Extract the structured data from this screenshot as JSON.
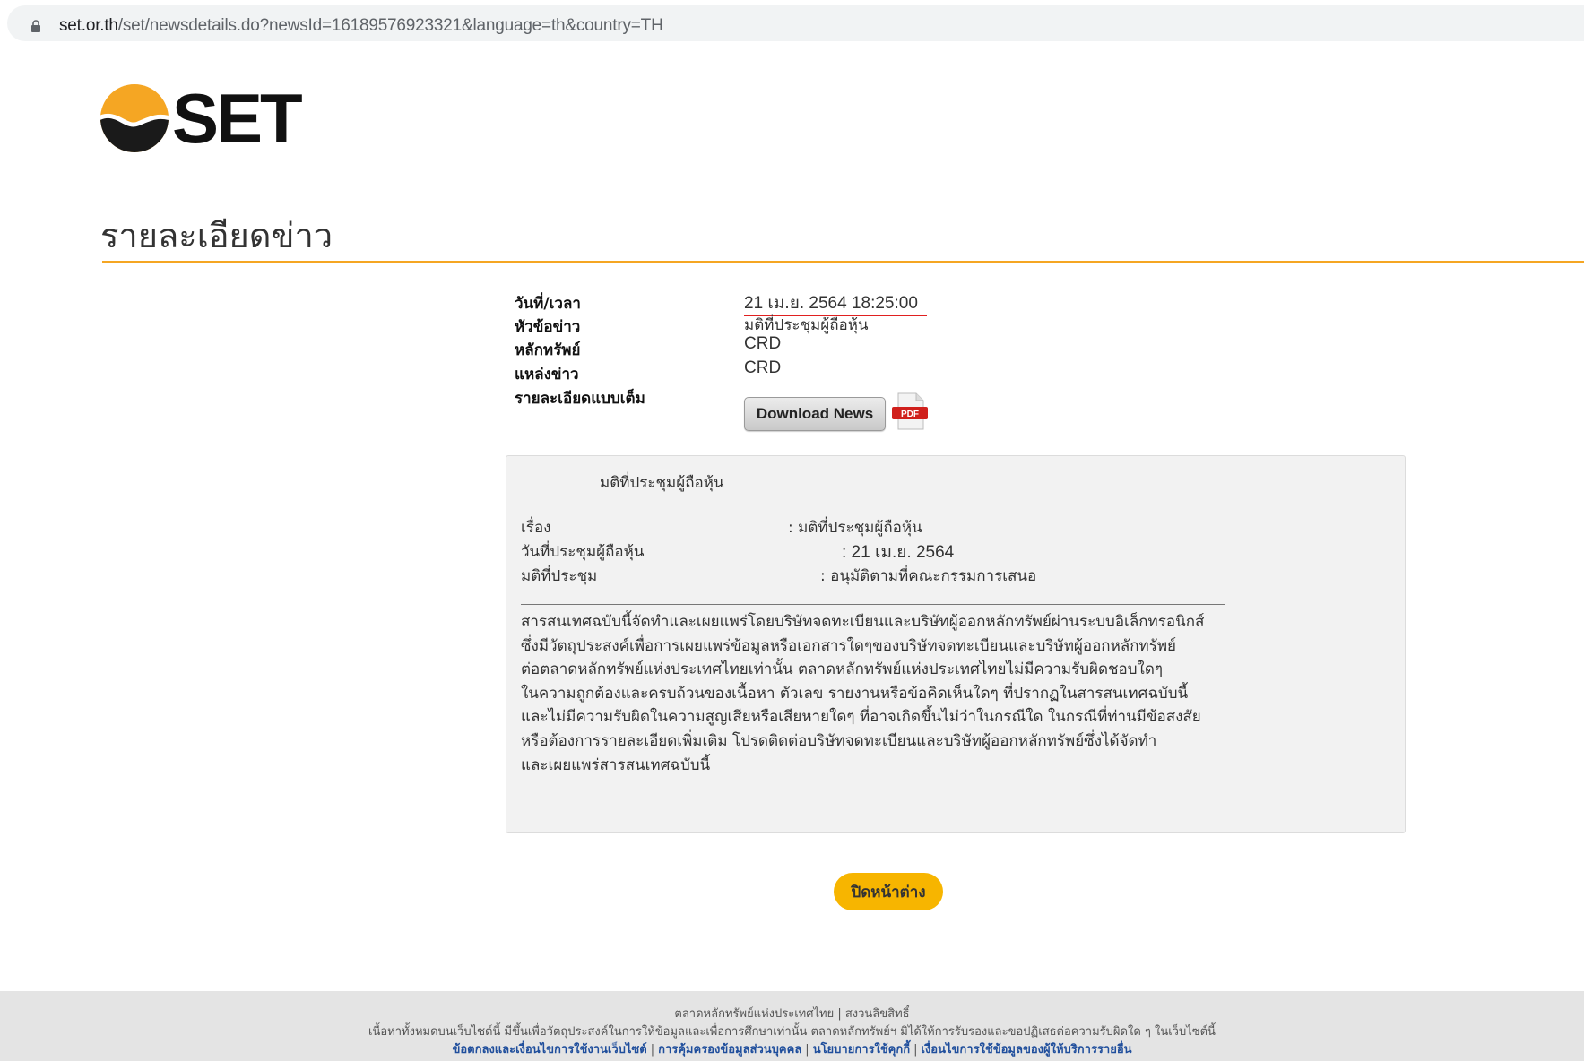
{
  "browser": {
    "url_host": "set.or.th",
    "url_path": "/set/newsdetails.do?newsId=16189576923321&language=th&country=TH"
  },
  "logo": {
    "text": "SET"
  },
  "page": {
    "title": "รายละเอียดข่าว"
  },
  "info": {
    "date_label": "วันที่/เวลา",
    "date_value": "21 เม.ย. 2564 18:25:00",
    "headline_label": "หัวข้อข่าว",
    "headline_value": "มติที่ประชุมผู้ถือหุ้น",
    "security_label": "หลักทรัพย์",
    "security_value": "CRD",
    "source_label": "แหล่งข่าว",
    "source_value": "CRD",
    "original_label": "รายละเอียดแบบเต็ม",
    "download_label": "Download News",
    "pdf_label": "PDF"
  },
  "content": {
    "heading": "มติที่ประชุมผู้ถือหุ้น",
    "rows": [
      {
        "key": "เรื่อง",
        "value": ": มติที่ประชุมผู้ถือหุ้น"
      },
      {
        "key": "วันที่ประชุมผู้ถือหุ้น",
        "value": ": 21 เม.ย. 2564"
      },
      {
        "key": "มติที่ประชุม",
        "value": ": อนุมัติตามที่คณะกรรมการเสนอ"
      }
    ],
    "disclaimer": [
      "สารสนเทศฉบับนี้จัดทำและเผยแพร่โดยบริษัทจดทะเบียนและบริษัทผู้ออกหลักทรัพย์ผ่านระบบอิเล็กทรอนิกส์",
      "ซึ่งมีวัตถุประสงค์เพื่อการเผยแพร่ข้อมูลหรือเอกสารใดๆของบริษัทจดทะเบียนและบริษัทผู้ออกหลักทรัพย์",
      "ต่อตลาดหลักทรัพย์แห่งประเทศไทยเท่านั้น ตลาดหลักทรัพย์แห่งประเทศไทยไม่มีความรับผิดชอบใดๆ",
      "ในความถูกต้องและครบถ้วนของเนื้อหา ตัวเลข รายงานหรือข้อคิดเห็นใดๆ ที่ปรากฏในสารสนเทศฉบับนี้",
      "และไม่มีความรับผิดในความสูญเสียหรือเสียหายใดๆ ที่อาจเกิดขึ้นไม่ว่าในกรณีใด ในกรณีที่ท่านมีข้อสงสัย",
      "หรือต้องการรายละเอียดเพิ่มเติม โปรดติดต่อบริษัทจดทะเบียนและบริษัทผู้ออกหลักทรัพย์ซึ่งได้จัดทำ",
      "และเผยแพร่สารสนเทศฉบับนี้"
    ]
  },
  "close_label": "ปิดหน้าต่าง",
  "footer": {
    "copyright": "ตลาดหลักทรัพย์แห่งประเทศไทย | สงวนลิขสิทธิ์",
    "notice": "เนื้อหาทั้งหมดบนเว็บไซต์นี้ มีขึ้นเพื่อวัตถุประสงค์ในการให้ข้อมูลและเพื่อการศึกษาเท่านั้น ตลาดหลักทรัพย์ฯ มิได้ให้การรับรองและขอปฏิเสธต่อความรับผิดใด ๆ ในเว็บไซต์นี้",
    "links": [
      "ข้อตกลงและเงื่อนไขการใช้งานเว็บไซต์",
      "การคุ้มครองข้อมูลส่วนบุคคล",
      "นโยบายการใช้คุกกี้",
      "เงื่อนไขการใช้ข้อมูลของผู้ให้บริการรายอื่น"
    ]
  },
  "colors": {
    "accent": "#f5a623",
    "close_button": "#f7b500",
    "underline": "#e02020",
    "footer_link": "#1f4e9c"
  },
  "icons": [
    "lock-icon",
    "set-logo-icon",
    "pdf-icon"
  ]
}
